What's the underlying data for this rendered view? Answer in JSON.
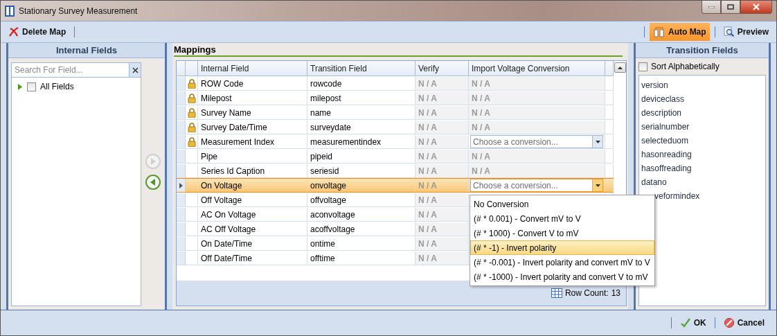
{
  "window": {
    "title": "Stationary Survey Measurement"
  },
  "toolbar": {
    "left": [
      {
        "label": "Delete Map",
        "kind": "delete",
        "active": false
      }
    ],
    "right": [
      {
        "label": "Auto Map",
        "kind": "automap",
        "active": true
      },
      {
        "label": "Preview",
        "kind": "preview",
        "active": false
      }
    ]
  },
  "internal_fields": {
    "title": "Internal Fields",
    "search": {
      "placeholder": "Search For Field..."
    },
    "tree": [
      {
        "label": "All Fields",
        "checked": false,
        "expanded": false
      }
    ]
  },
  "transfer_buttons": [
    {
      "kind": "right",
      "disabled": true
    },
    {
      "kind": "left",
      "disabled": false
    }
  ],
  "mappings": {
    "title": "Mappings",
    "columns": [
      "Internal Field",
      "Transition Field",
      "Verify",
      "Import Voltage Conversion"
    ],
    "rows": [
      {
        "internal": "ROW Code",
        "transition": "rowcode",
        "locked": true,
        "selected": false,
        "verify": "N / A",
        "conversion": {
          "kind": "text",
          "value": "N / A"
        }
      },
      {
        "internal": "Milepost",
        "transition": "milepost",
        "locked": true,
        "selected": false,
        "verify": "N / A",
        "conversion": {
          "kind": "text",
          "value": "N / A"
        }
      },
      {
        "internal": "Survey Name",
        "transition": "name",
        "locked": true,
        "selected": false,
        "verify": "N / A",
        "conversion": {
          "kind": "text",
          "value": "N / A"
        }
      },
      {
        "internal": "Survey Date/Time",
        "transition": "surveydate",
        "locked": true,
        "selected": false,
        "verify": "N / A",
        "conversion": {
          "kind": "text",
          "value": "N / A"
        }
      },
      {
        "internal": "Measurement Index",
        "transition": "measurementindex",
        "locked": true,
        "selected": false,
        "verify": "N / A",
        "conversion": {
          "kind": "combo",
          "placeholder": "Choose a conversion..."
        }
      },
      {
        "internal": "Pipe",
        "transition": "pipeid",
        "locked": false,
        "selected": false,
        "verify": "N / A",
        "conversion": {
          "kind": "text",
          "value": "N / A"
        }
      },
      {
        "internal": "Series Id Caption",
        "transition": "seriesid",
        "locked": false,
        "selected": false,
        "verify": "N / A",
        "conversion": {
          "kind": "text",
          "value": "N / A"
        }
      },
      {
        "internal": "On Voltage",
        "transition": "onvoltage",
        "locked": false,
        "selected": true,
        "verify": "N / A",
        "conversion": {
          "kind": "combo",
          "placeholder": "Choose a conversion..."
        }
      },
      {
        "internal": "Off Voltage",
        "transition": "offvoltage",
        "locked": false,
        "selected": false,
        "verify": "N / A"
      },
      {
        "internal": "AC On Voltage",
        "transition": "aconvoltage",
        "locked": false,
        "selected": false,
        "verify": "N / A"
      },
      {
        "internal": "AC Off Voltage",
        "transition": "acoffvoltage",
        "locked": false,
        "selected": false,
        "verify": "N / A"
      },
      {
        "internal": "On Date/Time",
        "transition": "ontime",
        "locked": false,
        "selected": false,
        "verify": "N / A"
      },
      {
        "internal": "Off Date/Time",
        "transition": "offtime",
        "locked": false,
        "selected": false,
        "verify": "N / A"
      }
    ],
    "row_count_label": "Row Count:",
    "row_count": "13"
  },
  "conversion_menu": {
    "options": [
      {
        "label": "No Conversion",
        "selected": false
      },
      {
        "label": "(# * 0.001) - Convert mV to V",
        "selected": false
      },
      {
        "label": "(# * 1000) - Convert V to mV",
        "selected": false
      },
      {
        "label": "(# * -1) - Invert polarity",
        "selected": true
      },
      {
        "label": "(# * -0.001) - Invert polarity and convert mV to V",
        "selected": false
      },
      {
        "label": "(# * -1000) - Invert polarity and convert V to mV",
        "selected": false
      }
    ]
  },
  "transition_fields": {
    "title": "Transition Fields",
    "sort": {
      "label": "Sort Alphabetically",
      "checked": false
    },
    "items": [
      {
        "label": "version",
        "kind": "full"
      },
      {
        "label": "deviceclass",
        "kind": "full"
      },
      {
        "label": "description",
        "kind": "full"
      },
      {
        "label": "serialnumber",
        "kind": "full"
      },
      {
        "label": "selecteduom",
        "kind": "full"
      },
      {
        "label": "hasonreading",
        "kind": "full"
      },
      {
        "label": "hasoffreading",
        "kind": "full"
      },
      {
        "label": "datano",
        "kind": "full"
      },
      {
        "label": "veformindex",
        "kind": "partial"
      }
    ]
  },
  "footer": {
    "buttons": [
      {
        "label": "OK",
        "kind": "ok"
      },
      {
        "label": "Cancel",
        "kind": "cancel"
      }
    ]
  }
}
